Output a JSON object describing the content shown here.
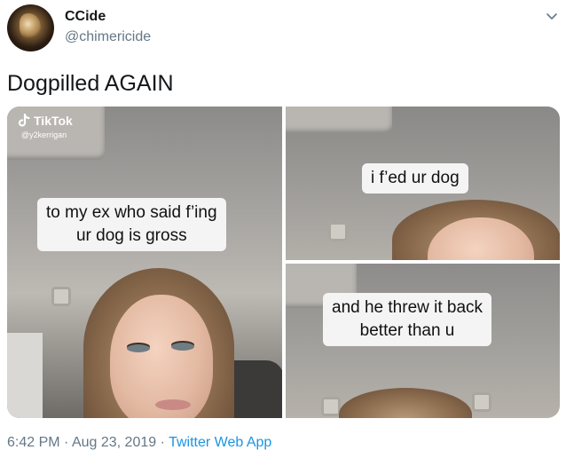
{
  "author": {
    "name": "CCide",
    "handle": "@chimericide"
  },
  "tweet": {
    "text": "Dogpilled AGAIN"
  },
  "media": {
    "watermark": {
      "brand": "TikTok",
      "user": "@y2kerrigan"
    },
    "captions": {
      "left": [
        "to my ex who said f’ing",
        "ur dog is gross"
      ],
      "top_right": [
        "i f’ed ur dog"
      ],
      "bottom_right": [
        "and he threw it back",
        "better than u"
      ]
    }
  },
  "footer": {
    "time": "6:42 PM",
    "separator": " · ",
    "date": "Aug 23, 2019",
    "source": "Twitter Web App"
  },
  "icons": {
    "menu": "chevron-down-icon",
    "brand": "tiktok-logo-icon"
  }
}
